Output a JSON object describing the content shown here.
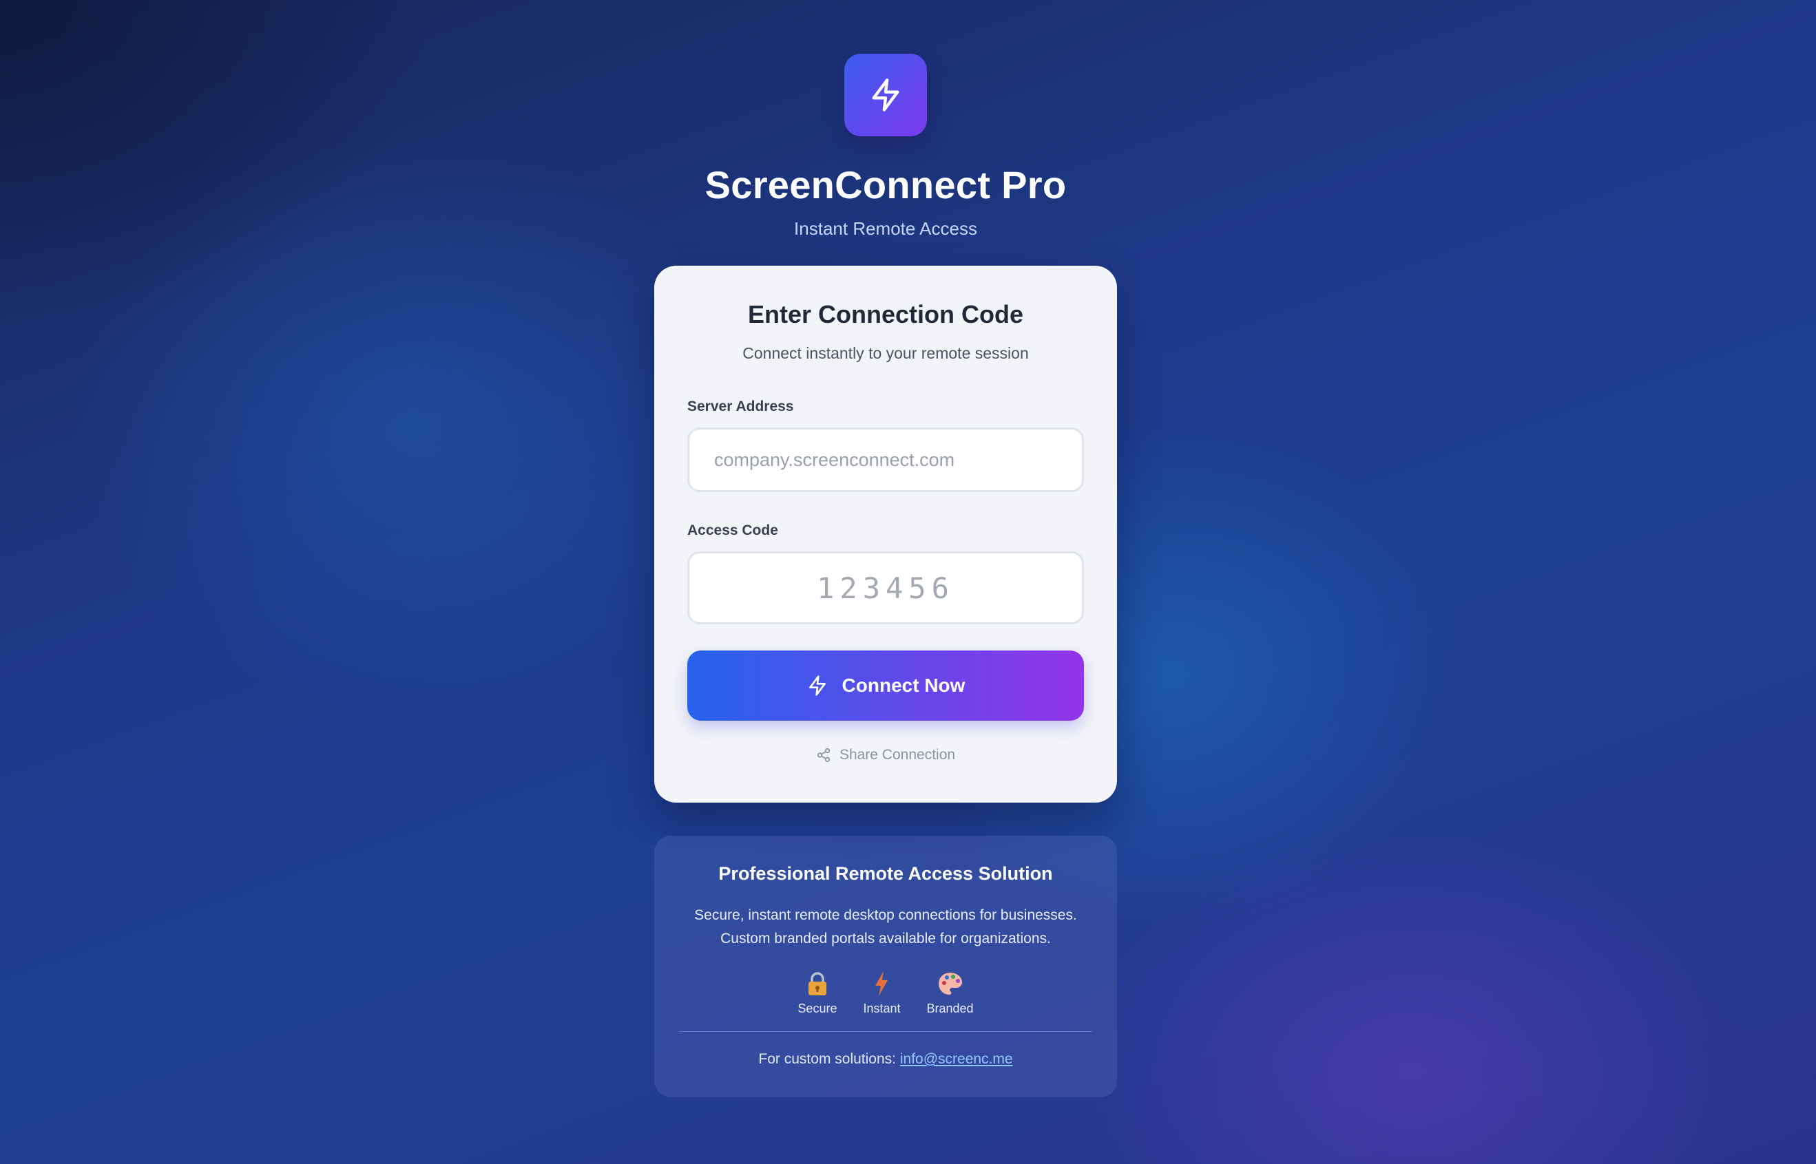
{
  "header": {
    "app_title": "ScreenConnect Pro",
    "app_subtitle": "Instant Remote Access",
    "logo_icon": "lightning-bolt-icon"
  },
  "connect_card": {
    "title": "Enter Connection Code",
    "subtitle": "Connect instantly to your remote session",
    "server_label": "Server Address",
    "server_placeholder": "company.screenconnect.com",
    "code_label": "Access Code",
    "code_placeholder": "123456",
    "connect_button_label": "Connect Now",
    "share_label": "Share Connection"
  },
  "info_card": {
    "title": "Professional Remote Access Solution",
    "text_line1": "Secure, instant remote desktop connections for businesses.",
    "text_line2": "Custom branded portals available for organizations.",
    "features": [
      {
        "label": "Secure",
        "icon": "lock-icon"
      },
      {
        "label": "Instant",
        "icon": "lightning-icon"
      },
      {
        "label": "Branded",
        "icon": "palette-icon"
      }
    ],
    "contact_prefix": "For custom solutions:",
    "contact_email": "info@screenc.me"
  },
  "colors": {
    "accent_start": "#2563eb",
    "accent_end": "#9333ea",
    "link": "#93c5fd"
  }
}
